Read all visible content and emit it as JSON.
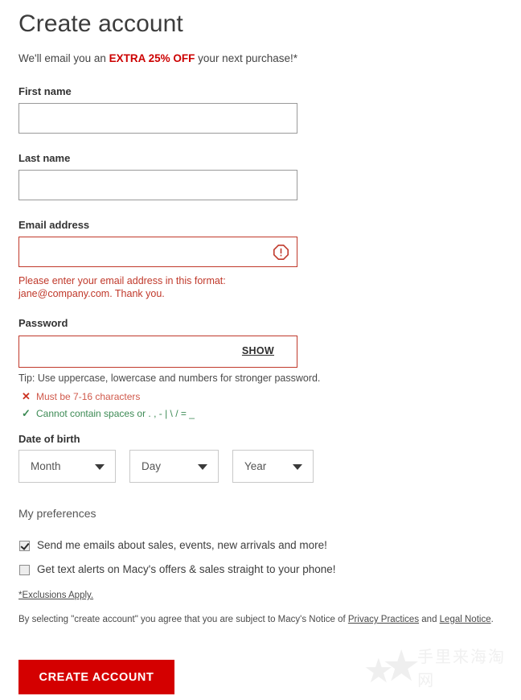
{
  "header": {
    "title": "Create account",
    "promo_prefix": "We'll email you an ",
    "promo_highlight": "EXTRA 25% OFF",
    "promo_suffix": " your next purchase!*"
  },
  "fields": {
    "first_name": {
      "label": "First name",
      "value": "",
      "placeholder": ""
    },
    "last_name": {
      "label": "Last name",
      "value": "",
      "placeholder": ""
    },
    "email": {
      "label": "Email address",
      "value": "",
      "placeholder": "",
      "error": "Please enter your email address in this format: jane@company.com. Thank you.",
      "icon": "error-octagon-icon"
    },
    "password": {
      "label": "Password",
      "value": "",
      "placeholder": "",
      "show_label": "SHOW",
      "tip": "Tip: Use uppercase, lowercase and numbers for stronger password.",
      "rules": [
        {
          "status": "fail",
          "mark": "✕",
          "text": "Must be 7-16 characters"
        },
        {
          "status": "pass",
          "mark": "✓",
          "text": "Cannot contain spaces or . , - | \\ / = _"
        }
      ]
    }
  },
  "dob": {
    "label": "Date of birth",
    "month": {
      "selected": "Month"
    },
    "day": {
      "selected": "Day"
    },
    "year": {
      "selected": "Year"
    }
  },
  "preferences": {
    "title": "My preferences",
    "items": [
      {
        "label": "Send me emails about sales, events, new arrivals and more!",
        "checked": true
      },
      {
        "label": "Get text alerts on Macy's offers & sales straight to your phone!",
        "checked": false
      }
    ]
  },
  "legal": {
    "exclusions": "*Exclusions Apply.",
    "text_before": "By selecting \"create account\" you agree that you are subject to Macy's Notice of ",
    "link_privacy": "Privacy Practices",
    "text_middle": " and ",
    "link_legal": "Legal Notice",
    "text_after": "."
  },
  "cta": {
    "label": "CREATE ACCOUNT"
  },
  "watermark": {
    "text": "手里来海淘网",
    "star": "★"
  },
  "colors": {
    "brand_red": "#d40000",
    "promo_red": "#cc0000",
    "error_red": "#c0392b",
    "rule_fail": "#d0594b",
    "rule_pass": "#3c8a54",
    "text": "#333333",
    "border_gray": "#9a9a9a"
  }
}
